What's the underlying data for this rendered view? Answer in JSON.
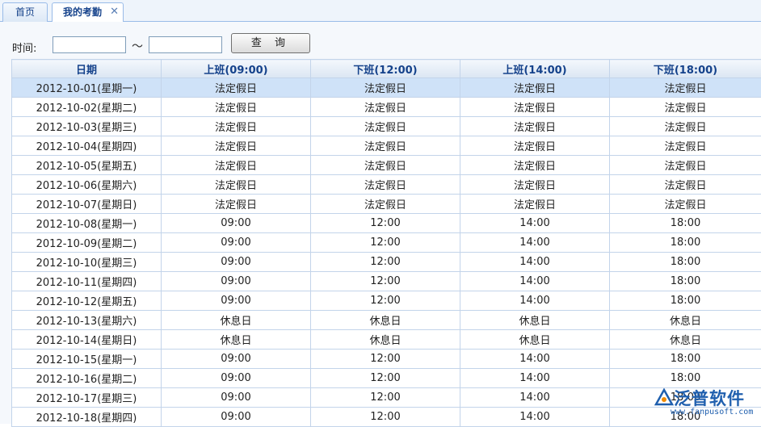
{
  "tabs": [
    {
      "label": "首页",
      "active": false
    },
    {
      "label": "我的考勤",
      "active": true
    }
  ],
  "search": {
    "label": "时间:",
    "separator": "～",
    "start_value": "",
    "end_value": "",
    "button_label": "查 询"
  },
  "table": {
    "columns": [
      "日期",
      "上班(09:00)",
      "下班(12:00)",
      "上班(14:00)",
      "下班(18:00)"
    ],
    "rows": [
      [
        "2012-10-01(星期一)",
        "法定假日",
        "法定假日",
        "法定假日",
        "法定假日"
      ],
      [
        "2012-10-02(星期二)",
        "法定假日",
        "法定假日",
        "法定假日",
        "法定假日"
      ],
      [
        "2012-10-03(星期三)",
        "法定假日",
        "法定假日",
        "法定假日",
        "法定假日"
      ],
      [
        "2012-10-04(星期四)",
        "法定假日",
        "法定假日",
        "法定假日",
        "法定假日"
      ],
      [
        "2012-10-05(星期五)",
        "法定假日",
        "法定假日",
        "法定假日",
        "法定假日"
      ],
      [
        "2012-10-06(星期六)",
        "法定假日",
        "法定假日",
        "法定假日",
        "法定假日"
      ],
      [
        "2012-10-07(星期日)",
        "法定假日",
        "法定假日",
        "法定假日",
        "法定假日"
      ],
      [
        "2012-10-08(星期一)",
        "09:00",
        "12:00",
        "14:00",
        "18:00"
      ],
      [
        "2012-10-09(星期二)",
        "09:00",
        "12:00",
        "14:00",
        "18:00"
      ],
      [
        "2012-10-10(星期三)",
        "09:00",
        "12:00",
        "14:00",
        "18:00"
      ],
      [
        "2012-10-11(星期四)",
        "09:00",
        "12:00",
        "14:00",
        "18:00"
      ],
      [
        "2012-10-12(星期五)",
        "09:00",
        "12:00",
        "14:00",
        "18:00"
      ],
      [
        "2012-10-13(星期六)",
        "休息日",
        "休息日",
        "休息日",
        "休息日"
      ],
      [
        "2012-10-14(星期日)",
        "休息日",
        "休息日",
        "休息日",
        "休息日"
      ],
      [
        "2012-10-15(星期一)",
        "09:00",
        "12:00",
        "14:00",
        "18:00"
      ],
      [
        "2012-10-16(星期二)",
        "09:00",
        "12:00",
        "14:00",
        "18:00"
      ],
      [
        "2012-10-17(星期三)",
        "09:00",
        "12:00",
        "14:00",
        "18:00"
      ],
      [
        "2012-10-18(星期四)",
        "09:00",
        "12:00",
        "14:00",
        "18:00"
      ]
    ],
    "selected_row": 0
  },
  "watermark": {
    "name": "泛普软件",
    "url": "www.fanpusoft.com"
  },
  "colors": {
    "header_text": "#15428b",
    "border": "#c3d4ea",
    "selected_row": "#cfe2f8",
    "brand": "#1f5fae"
  }
}
